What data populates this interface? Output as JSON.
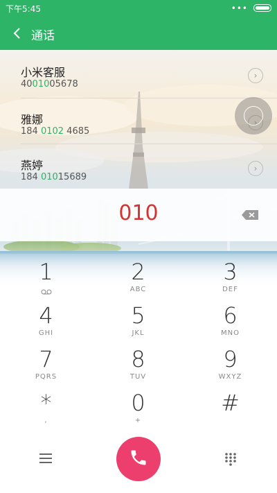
{
  "status": {
    "time": "下午5:45",
    "menu_dots": "•••"
  },
  "header": {
    "title": "通话",
    "back_icon": "chevron-left-icon"
  },
  "contacts": [
    {
      "name": "小米客服",
      "number_pre": "40",
      "number_match": "010",
      "number_post": "05678"
    },
    {
      "name": "雅娜",
      "number_pre": "184 ",
      "number_match": "0102",
      "number_post": " 4685"
    },
    {
      "name": "燕婷",
      "number_pre": "184 ",
      "number_match": "010",
      "number_post": "15689"
    }
  ],
  "dialer": {
    "entered_number": "010",
    "number_color": "#d63232"
  },
  "keypad": [
    {
      "digit": "1",
      "letters": ""
    },
    {
      "digit": "2",
      "letters": "ABC"
    },
    {
      "digit": "3",
      "letters": "DEF"
    },
    {
      "digit": "4",
      "letters": "GHI"
    },
    {
      "digit": "5",
      "letters": "JKL"
    },
    {
      "digit": "6",
      "letters": "MNO"
    },
    {
      "digit": "7",
      "letters": "PQRS"
    },
    {
      "digit": "8",
      "letters": "TUV"
    },
    {
      "digit": "9",
      "letters": "WXYZ"
    },
    {
      "digit": "*",
      "letters": ","
    },
    {
      "digit": "0",
      "letters": "+"
    },
    {
      "digit": "#",
      "letters": ""
    }
  ],
  "bottom_bar": {
    "menu_icon": "hamburger-menu-icon",
    "call_icon": "phone-icon",
    "keypad_icon": "dialpad-grid-icon"
  },
  "colors": {
    "accent": "#2eb467",
    "call": "#ec3f6d",
    "dial_number": "#d63232"
  }
}
